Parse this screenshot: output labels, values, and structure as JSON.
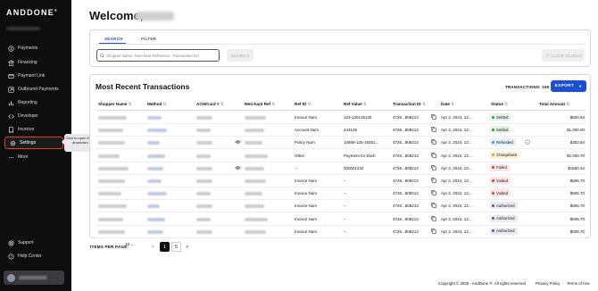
{
  "brand": {
    "logo": "ANDDONE"
  },
  "sidebar": {
    "items": [
      {
        "label": "Payments",
        "icon": "dollar-icon"
      },
      {
        "label": "Financing",
        "icon": "bank-icon"
      },
      {
        "label": "Payment Link",
        "icon": "link-icon"
      },
      {
        "label": "Outbound Payments",
        "icon": "outbound-icon"
      },
      {
        "label": "Reporting",
        "icon": "report-icon"
      },
      {
        "label": "Developer",
        "icon": "code-icon"
      },
      {
        "label": "Invoices",
        "icon": "invoice-icon"
      },
      {
        "label": "Settings",
        "icon": "gear-icon"
      },
      {
        "label": "More",
        "icon": "more-icon"
      }
    ],
    "bottom": [
      {
        "label": "Support",
        "icon": "support-icon"
      },
      {
        "label": "Help Center",
        "icon": "help-icon"
      }
    ],
    "tooltip": "Click to open the Settings dropdown menu."
  },
  "header": {
    "welcome": "Welcome,"
  },
  "search": {
    "tabs": [
      "SEARCH",
      "FILTER"
    ],
    "placeholder": "Shopper Name, Merchant Reference, Transaction ID)",
    "search_button": "SEARCH",
    "clear_button": "CLEAR SEARCH"
  },
  "transactions": {
    "title": "Most Recent Transactions",
    "count_label": "TRANSACTIONS: 150",
    "export_label": "EXPORT",
    "columns": [
      "Shopper Name",
      "Method",
      "ACH/Card #",
      "Merchant Ref",
      "Ref ID",
      "Ref Value",
      "Transaction ID",
      "Date",
      "Status",
      "Total Amount"
    ],
    "rows": [
      {
        "ref_id": "Invoice Num",
        "ref_value": "123-125125125",
        "txn_id": "4726...808213",
        "date": "Apr 3, 2024, 12:...",
        "status": "Settled",
        "amount": "$500.94",
        "eye": false
      },
      {
        "ref_id": "Account Num",
        "ref_value": "444125",
        "txn_id": "4726...808213",
        "date": "Apr 3, 2024, 12:...",
        "status": "Settled",
        "amount": "$1,000.00",
        "eye": false
      },
      {
        "ref_id": "Policy Num",
        "ref_value": "10909-125-19251...",
        "txn_id": "4726...808213",
        "date": "Apr 3, 2024, 12:...",
        "status": "Refunded",
        "amount": "$353.84",
        "eye": true,
        "info": true
      },
      {
        "ref_id": "Other",
        "ref_value": "Payment for Zach",
        "txn_id": "4726...808213",
        "date": "Apr 3, 2024, 12:...",
        "status": "Chargeback",
        "amount": "$2,000.70",
        "eye": false
      },
      {
        "ref_id": "--",
        "ref_value": "000001234",
        "txn_id": "4726...808213",
        "date": "Apr 3, 2024, 12:...",
        "status": "Failed",
        "amount": "$1560.34",
        "eye": true
      },
      {
        "ref_id": "Invoice Num",
        "ref_value": "--",
        "txn_id": "4726...808213",
        "date": "Apr 3, 2024, 12:...",
        "status": "Voided",
        "amount": "$505.70",
        "eye": false
      },
      {
        "ref_id": "Invoice Num",
        "ref_value": "--",
        "txn_id": "4726...808213",
        "date": "Apr 3, 2024, 12:...",
        "status": "Voided",
        "amount": "$505.70",
        "eye": false
      },
      {
        "ref_id": "Invoice Num",
        "ref_value": "--",
        "txn_id": "4726...808213",
        "date": "Apr 3, 2024, 12:...",
        "status": "Authorized",
        "amount": "$505.70",
        "eye": false
      },
      {
        "ref_id": "Invoice Num",
        "ref_value": "--",
        "txn_id": "4726...808213",
        "date": "Apr 3, 2024, 12:...",
        "status": "Authorized",
        "amount": "$505.70",
        "eye": false
      },
      {
        "ref_id": "Invoice Num",
        "ref_value": "--",
        "txn_id": "4726...808213",
        "date": "Apr 3, 2024, 12:...",
        "status": "Authorized",
        "amount": "$505.70",
        "eye": false
      }
    ]
  },
  "status_colors": {
    "Settled": {
      "bg": "#e3f4e6",
      "dot": "#2e9e47"
    },
    "Refunded": {
      "bg": "#e3f1fb",
      "dot": "#29a0e0"
    },
    "Chargeback": {
      "bg": "#fcf3dc",
      "dot": "#e0a020"
    },
    "Failed": {
      "bg": "#fde6e6",
      "dot": "#e0383b"
    },
    "Voided": {
      "bg": "#fde6e6",
      "dot": "#e0383b"
    },
    "Authorized": {
      "bg": "#ecebf3",
      "dot": "#5a4f9a"
    }
  },
  "pagination": {
    "items_per_page_label": "ITEMS PER PAGE:",
    "items_per_page": "10",
    "pages": [
      "1",
      "5"
    ],
    "prev": "<",
    "next": ">"
  },
  "footer": {
    "copyright": "Copyright © 2025 - AndDone ®. All rights reserved",
    "privacy": "Privacy Policy",
    "terms": "Terms of Use"
  },
  "accent_color": "#1f4fd1"
}
